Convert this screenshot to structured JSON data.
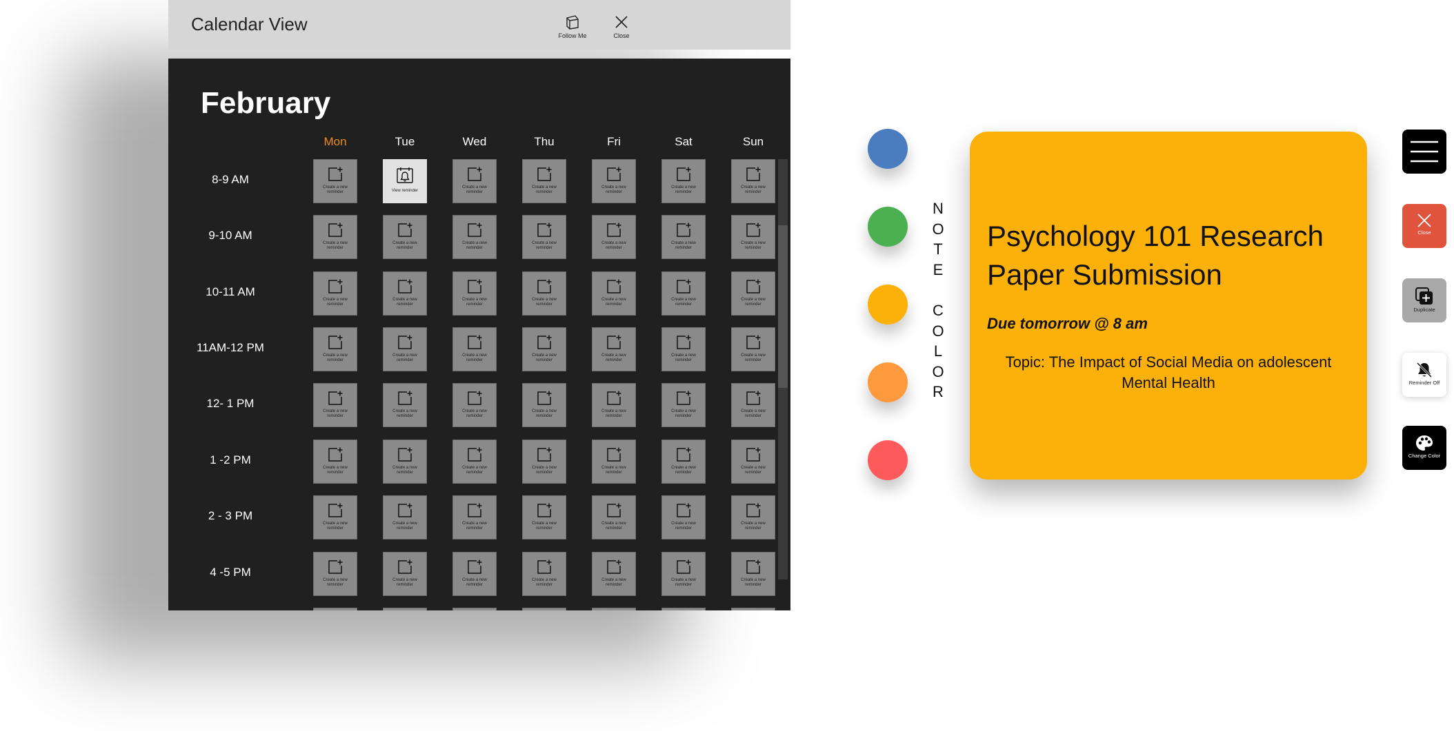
{
  "window": {
    "title": "Calendar View",
    "follow_label": "Follow Me",
    "close_label": "Close"
  },
  "calendar": {
    "month": "February",
    "days": [
      "Mon",
      "Tue",
      "Wed",
      "Thu",
      "Fri",
      "Sat",
      "Sun"
    ],
    "today_day": "Mon",
    "times": [
      "8-9 AM",
      "9-10 AM",
      "10-11 AM",
      "11AM-12 PM",
      "12- 1 PM",
      "1 -2 PM",
      "2 - 3 PM",
      "4 -5 PM",
      ""
    ],
    "create_label": "Create a new reminder",
    "view_label": "View reminder",
    "active_slot": {
      "time_index": 0,
      "day_index": 1
    }
  },
  "note_color": {
    "label_word1": "NOTE",
    "label_word2": "COLOR",
    "swatches": [
      {
        "name": "blue",
        "color": "#4a7dbf"
      },
      {
        "name": "green",
        "color": "#4caf50"
      },
      {
        "name": "yellow",
        "color": "#fbb10a"
      },
      {
        "name": "orange",
        "color": "#fd9a3e"
      },
      {
        "name": "red",
        "color": "#fd5a5b"
      }
    ],
    "selected": "yellow"
  },
  "note": {
    "bg_color": "#fbb10a",
    "title": "Psychology 101 Research Paper Submission",
    "due": "Due tomorrow @ 8 am",
    "topic": "Topic: The Impact of Social Media on adolescent Mental Health"
  },
  "side_buttons": {
    "close": "Close",
    "duplicate": "Duplicate",
    "reminder_off": "Reminder Off",
    "change_color": "Change Color"
  }
}
